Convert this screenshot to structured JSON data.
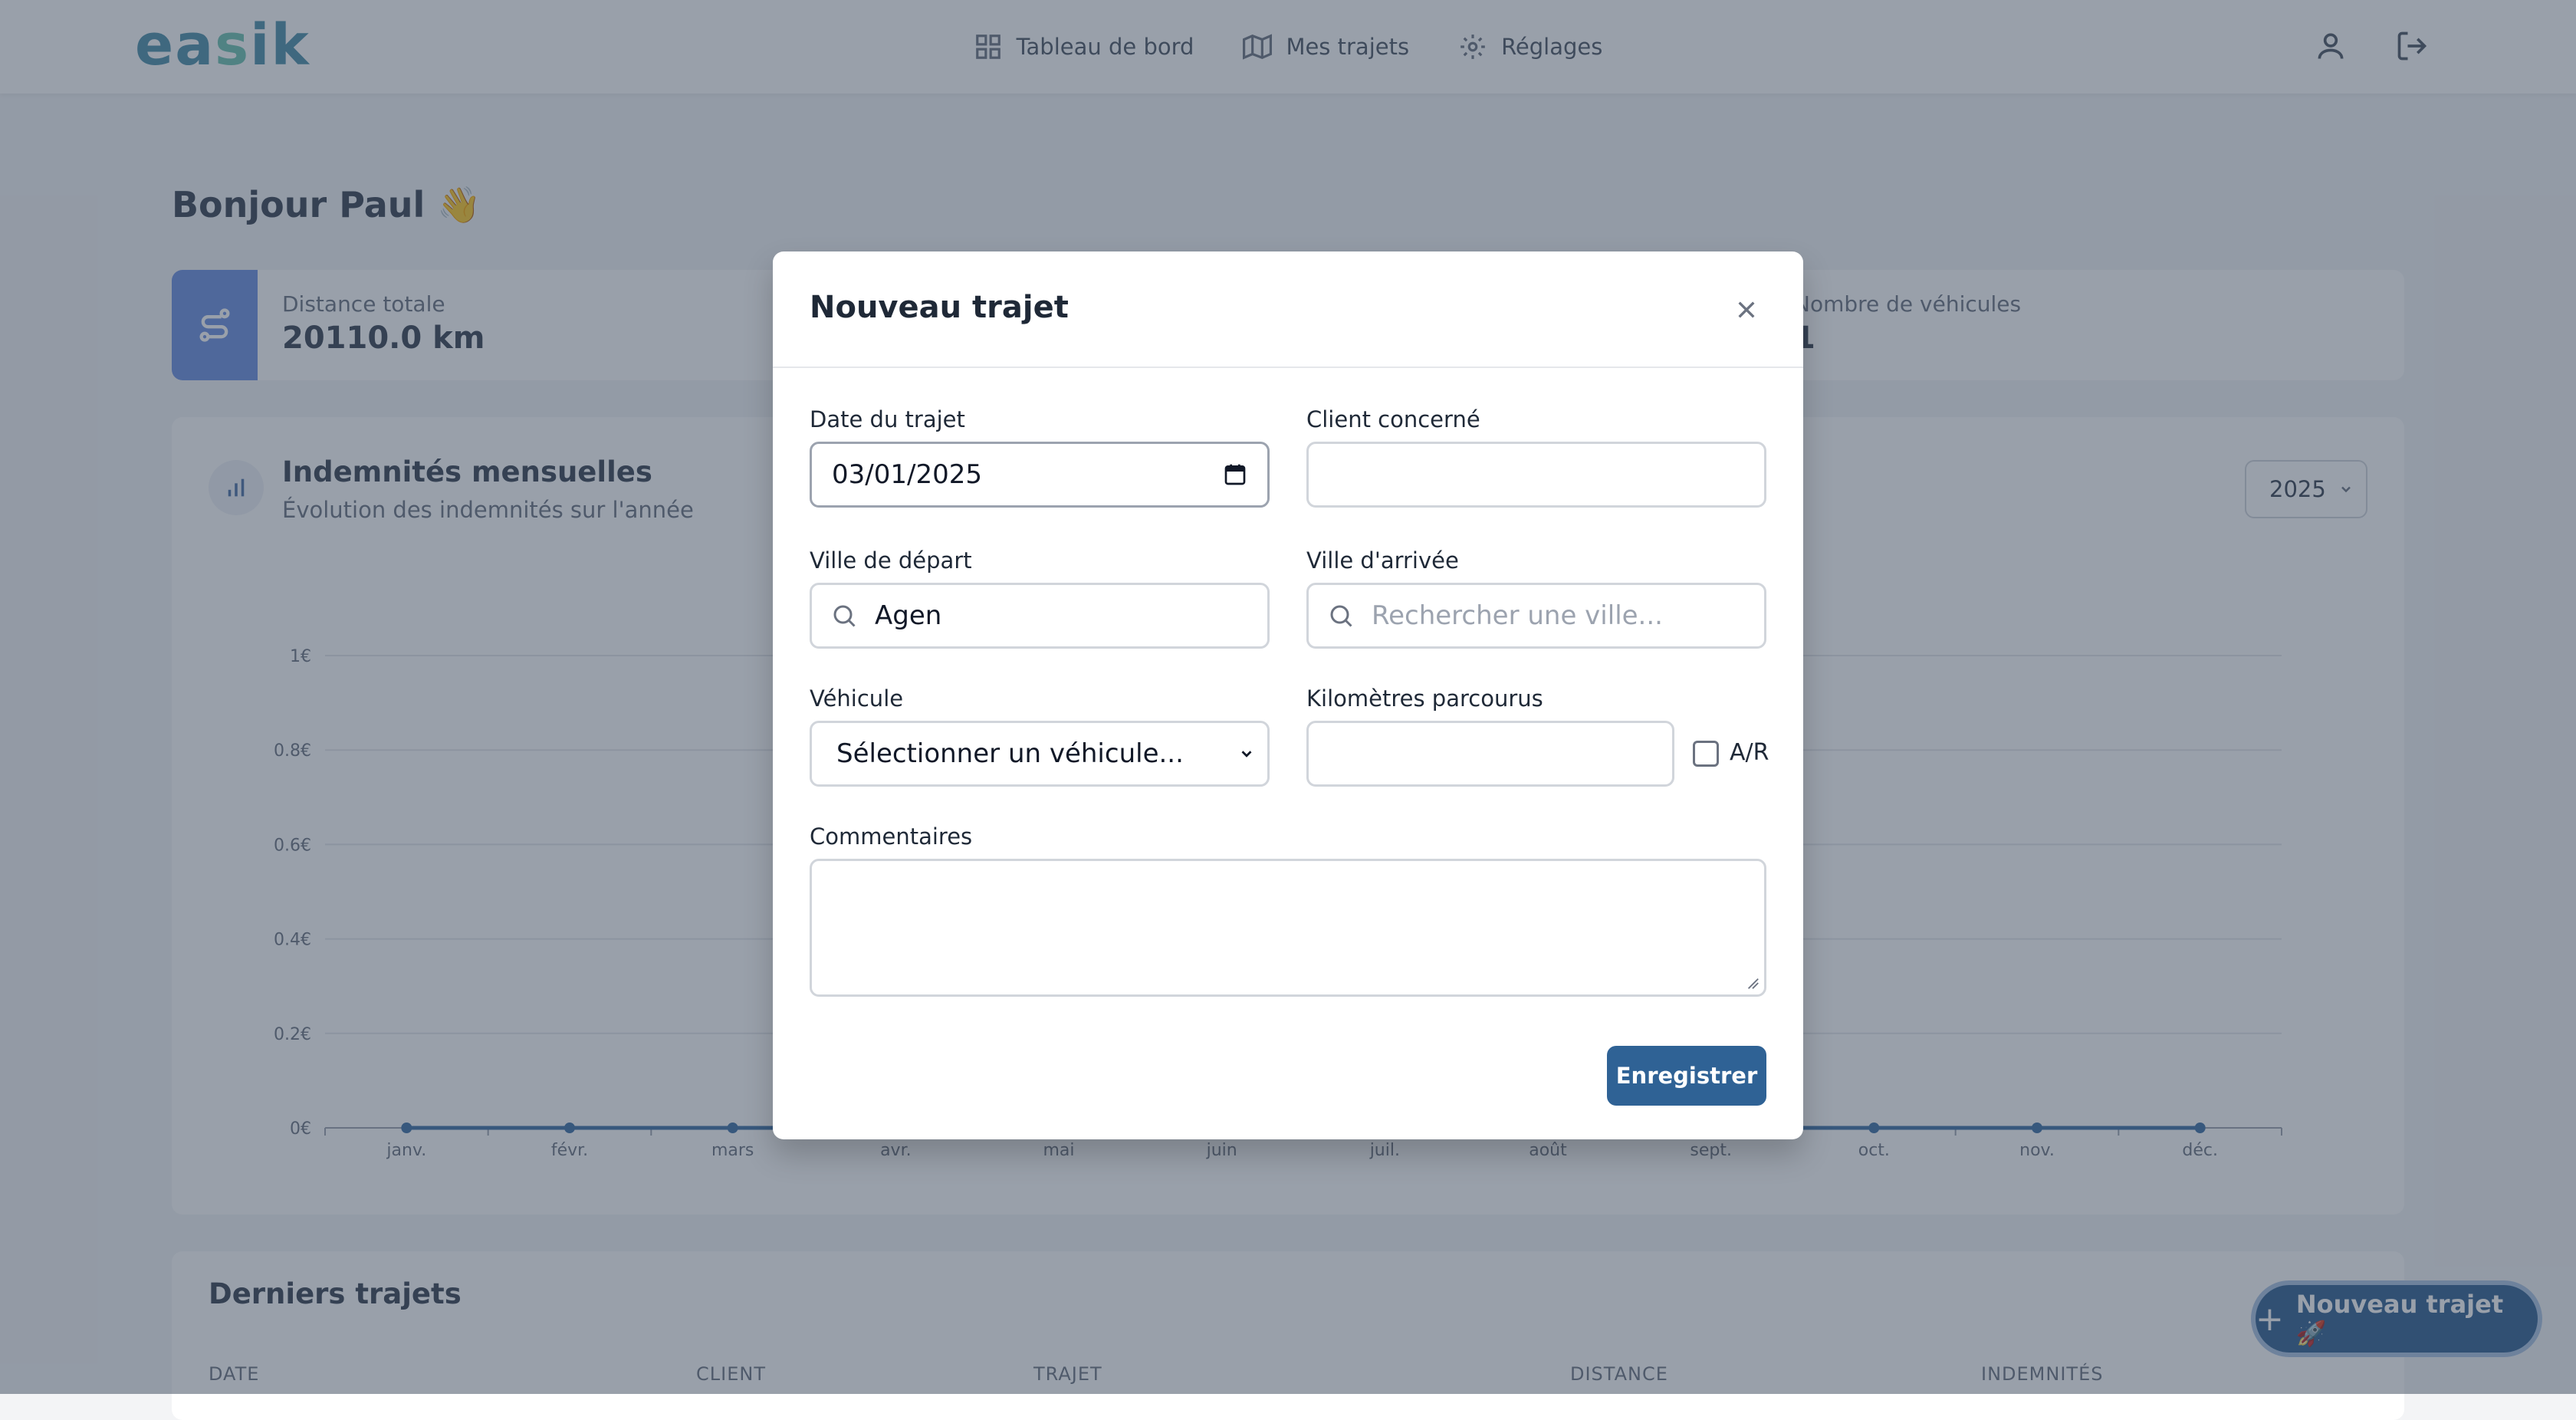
{
  "header": {
    "logo_text": "easik",
    "nav": [
      {
        "label": "Tableau de bord",
        "icon": "dashboard-icon"
      },
      {
        "label": "Mes trajets",
        "icon": "map-icon"
      },
      {
        "label": "Réglages",
        "icon": "gear-icon"
      }
    ]
  },
  "greeting": "Bonjour Paul 👋",
  "stats": [
    {
      "label": "Distance totale",
      "value": "20110.0 km",
      "icon": "route-icon"
    },
    {
      "label": "Nombre de véhicules",
      "value": "1",
      "icon": "car-icon"
    }
  ],
  "chart": {
    "title": "Indemnités mensuelles",
    "subtitle": "Évolution des indemnités sur l'année",
    "year": "2025"
  },
  "chart_data": {
    "type": "line",
    "categories": [
      "janv.",
      "févr.",
      "mars",
      "avr.",
      "mai",
      "juin",
      "juil.",
      "août",
      "sept.",
      "oct.",
      "nov.",
      "déc."
    ],
    "series": [
      {
        "values": [
          0,
          0,
          0,
          0,
          0,
          0,
          0,
          0,
          0,
          0,
          0,
          0
        ]
      }
    ],
    "yticks": [
      "0€",
      "0.2€",
      "0.4€",
      "0.6€",
      "0.8€",
      "1€"
    ],
    "ylim": [
      0,
      1
    ],
    "grid": true
  },
  "recent": {
    "title": "Derniers trajets",
    "columns": [
      "DATE",
      "CLIENT",
      "TRAJET",
      "DISTANCE",
      "INDEMNITÉS"
    ]
  },
  "fab_label": "Nouveau trajet 🚀",
  "modal": {
    "title": "Nouveau trajet",
    "date_label": "Date du trajet",
    "date_value": "03/01/2025",
    "client_label": "Client concerné",
    "client_value": "",
    "depart_label": "Ville de départ",
    "depart_value": "Agen",
    "arrivee_label": "Ville d'arrivée",
    "arrivee_placeholder": "Rechercher une ville...",
    "vehicule_label": "Véhicule",
    "vehicule_value": "Sélectionner un véhicule...",
    "km_label": "Kilomètres parcourus",
    "km_value": "",
    "ar_label": "A/R",
    "ar_checked": false,
    "comments_label": "Commentaires",
    "save_label": "Enregistrer"
  }
}
